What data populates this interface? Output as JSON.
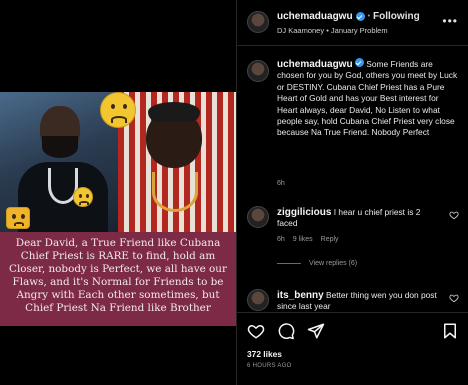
{
  "post": {
    "username": "uchemaduagwu",
    "follow_status": "Following",
    "audio": "DJ Kaamoney • January Problem",
    "more_icon": "more-horizontal-icon",
    "image_caption": "Dear David, a True Friend like Cubana Chief Priest is RARE to find, hold am Closer, nobody is Perfect, we all have our Flaws, and it's Normal for Friends to be Angry with Each other sometimes, but Chief Priest Na Friend like Brother"
  },
  "caption": {
    "username": "uchemaduagwu",
    "text": "Some Friends are chosen for you by God, others you meet by Luck or DESTINY. Cubana Chief Priest has a Pure Heart of Gold and has your Best interest for Heart always, dear David, No Listen to what people say, hold Cubana Chief Priest very close because Na True Friend. Nobody Perfect",
    "age": "6h"
  },
  "comments": [
    {
      "username": "ziggilicious",
      "text": "I hear u chief priest is 2 faced",
      "age": "6h",
      "likes": "9 likes",
      "reply": "Reply",
      "view_replies": "View replies (6)"
    },
    {
      "username": "its_benny",
      "text": "Better thing wen you don post since last year"
    }
  ],
  "footer": {
    "likes": "372 likes",
    "time": "6 HOURS AGO"
  },
  "colors": {
    "caption_bg": "#7c2a46",
    "verified": "#3897f0"
  }
}
